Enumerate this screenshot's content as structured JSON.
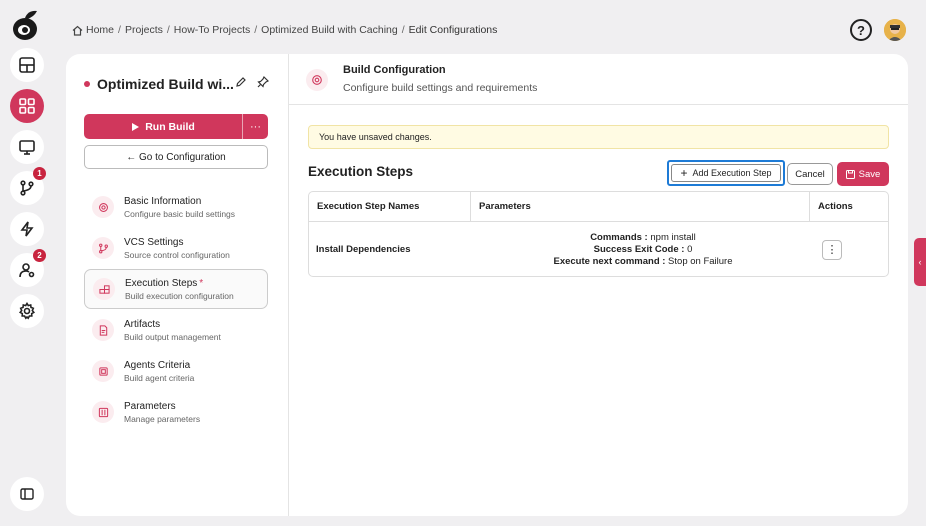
{
  "breadcrumb": [
    "Home",
    "Projects",
    "How-To Projects",
    "Optimized Build with Caching",
    "Edit Configurations"
  ],
  "rail": {
    "notifications_badge": "1",
    "users_badge": "2"
  },
  "build": {
    "name": "Optimized Build wi...",
    "run_label": "Run Build",
    "more_label": "···",
    "goto_label": "← Go to Configuration"
  },
  "nav": [
    {
      "title": "Basic Information",
      "subtitle": "Configure basic build settings",
      "icon": "gear-icon"
    },
    {
      "title": "VCS Settings",
      "subtitle": "Source control configuration",
      "icon": "git-branch-icon"
    },
    {
      "title": "Execution Steps",
      "subtitle": "Build execution configuration",
      "icon": "steps-icon",
      "required": "*"
    },
    {
      "title": "Artifacts",
      "subtitle": "Build output management",
      "icon": "file-icon"
    },
    {
      "title": "Agents Criteria",
      "subtitle": "Build agent criteria",
      "icon": "chip-icon"
    },
    {
      "title": "Parameters",
      "subtitle": "Manage parameters",
      "icon": "sliders-icon"
    }
  ],
  "header": {
    "title": "Build Configuration",
    "subtitle": "Configure build settings and requirements"
  },
  "notice": "You have unsaved changes.",
  "section": {
    "title": "Execution Steps",
    "add_label": "Add Execution Step",
    "cancel_label": "Cancel",
    "save_label": "Save"
  },
  "table": {
    "headers": [
      "Execution Step Names",
      "Parameters",
      "Actions"
    ],
    "rows": [
      {
        "name": "Install Dependencies",
        "params": [
          {
            "key": "Commands :",
            "value": " npm install"
          },
          {
            "key": "Success Exit Code :",
            "value": " 0"
          },
          {
            "key": "Execute next command :",
            "value": " Stop on Failure"
          }
        ],
        "action": "⋮"
      }
    ]
  },
  "colors": {
    "accent": "#d0375c",
    "focus": "#1e7bd6",
    "notice_bg": "#fffbe3"
  }
}
